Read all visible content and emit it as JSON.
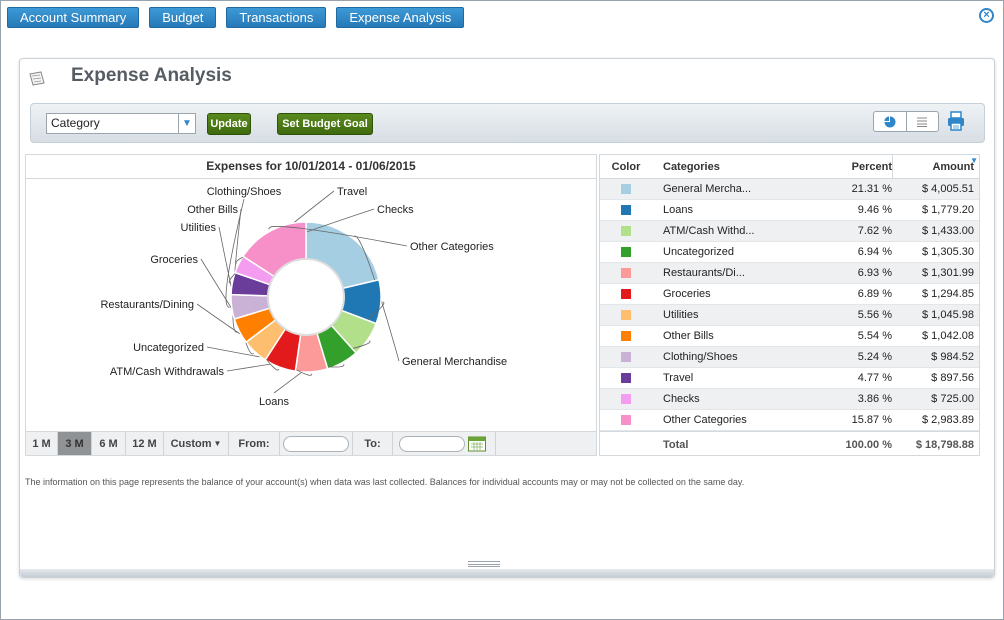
{
  "nav": {
    "tabs": [
      "Account Summary",
      "Budget",
      "Transactions",
      "Expense Analysis"
    ]
  },
  "page": {
    "title": "Expense Analysis"
  },
  "toolbar": {
    "group_by_value": "Category",
    "update_label": "Update",
    "budget_goal_label": "Set Budget Goal"
  },
  "chart_data": {
    "type": "pie",
    "title": "Expenses for 10/01/2014 - 01/06/2015",
    "donut": true,
    "slices": [
      {
        "label": "General Merchandise",
        "value": 21.31,
        "color": "#a6cee3"
      },
      {
        "label": "Loans",
        "value": 9.46,
        "color": "#1f78b4"
      },
      {
        "label": "ATM/Cash Withdrawals",
        "value": 7.62,
        "color": "#b2df8a"
      },
      {
        "label": "Uncategorized",
        "value": 6.94,
        "color": "#33a02c"
      },
      {
        "label": "Restaurants/Dining",
        "value": 6.93,
        "color": "#fb9a99"
      },
      {
        "label": "Groceries",
        "value": 6.89,
        "color": "#e31a1c"
      },
      {
        "label": "Utilities",
        "value": 5.56,
        "color": "#fdbf6f"
      },
      {
        "label": "Other Bills",
        "value": 5.54,
        "color": "#ff7f00"
      },
      {
        "label": "Clothing/Shoes",
        "value": 5.24,
        "color": "#cab2d6"
      },
      {
        "label": "Travel",
        "value": 4.77,
        "color": "#6a3d9a"
      },
      {
        "label": "Checks",
        "value": 3.86,
        "color": "#f49cf0"
      },
      {
        "label": "Other Categories",
        "value": 15.87,
        "color": "#f78fc8"
      }
    ]
  },
  "range": {
    "options": [
      "1 M",
      "3 M",
      "6 M",
      "12 M",
      "Custom"
    ],
    "selected": "3 M",
    "from_label": "From:",
    "to_label": "To:"
  },
  "table": {
    "headers": [
      "Color",
      "Categories",
      "Percent",
      "Amount"
    ],
    "rows": [
      {
        "category": "General Mercha...",
        "percent": "21.31 %",
        "amount": "$ 4,005.51",
        "color": "#a6cee3"
      },
      {
        "category": "Loans",
        "percent": "9.46 %",
        "amount": "$ 1,779.20",
        "color": "#1f78b4"
      },
      {
        "category": "ATM/Cash Withd...",
        "percent": "7.62 %",
        "amount": "$ 1,433.00",
        "color": "#b2df8a"
      },
      {
        "category": "Uncategorized",
        "percent": "6.94 %",
        "amount": "$ 1,305.30",
        "color": "#33a02c"
      },
      {
        "category": "Restaurants/Di...",
        "percent": "6.93 %",
        "amount": "$ 1,301.99",
        "color": "#fb9a99"
      },
      {
        "category": "Groceries",
        "percent": "6.89 %",
        "amount": "$ 1,294.85",
        "color": "#e31a1c"
      },
      {
        "category": "Utilities",
        "percent": "5.56 %",
        "amount": "$ 1,045.98",
        "color": "#fdbf6f"
      },
      {
        "category": "Other Bills",
        "percent": "5.54 %",
        "amount": "$ 1,042.08",
        "color": "#ff7f00"
      },
      {
        "category": "Clothing/Shoes",
        "percent": "5.24 %",
        "amount": "$ 984.52",
        "color": "#cab2d6"
      },
      {
        "category": "Travel",
        "percent": "4.77 %",
        "amount": "$ 897.56",
        "color": "#6a3d9a"
      },
      {
        "category": "Checks",
        "percent": "3.86 %",
        "amount": "$ 725.00",
        "color": "#f49cf0"
      },
      {
        "category": "Other Categories",
        "percent": "15.87 %",
        "amount": "$ 2,983.89",
        "color": "#f78fc8"
      }
    ],
    "total_label": "Total",
    "total_percent": "100.00 %",
    "total_amount": "$ 18,798.88"
  },
  "footnote": "The information on this page represents the balance of your account(s) when data was last collected. Balances for individual accounts may or may not be collected on the same day.",
  "icons": {
    "close": "close-icon",
    "pie_view": "pie-chart-icon",
    "list_view": "list-icon",
    "print": "printer-icon",
    "calendar": "calendar-icon",
    "sort": "sort-desc-icon"
  }
}
